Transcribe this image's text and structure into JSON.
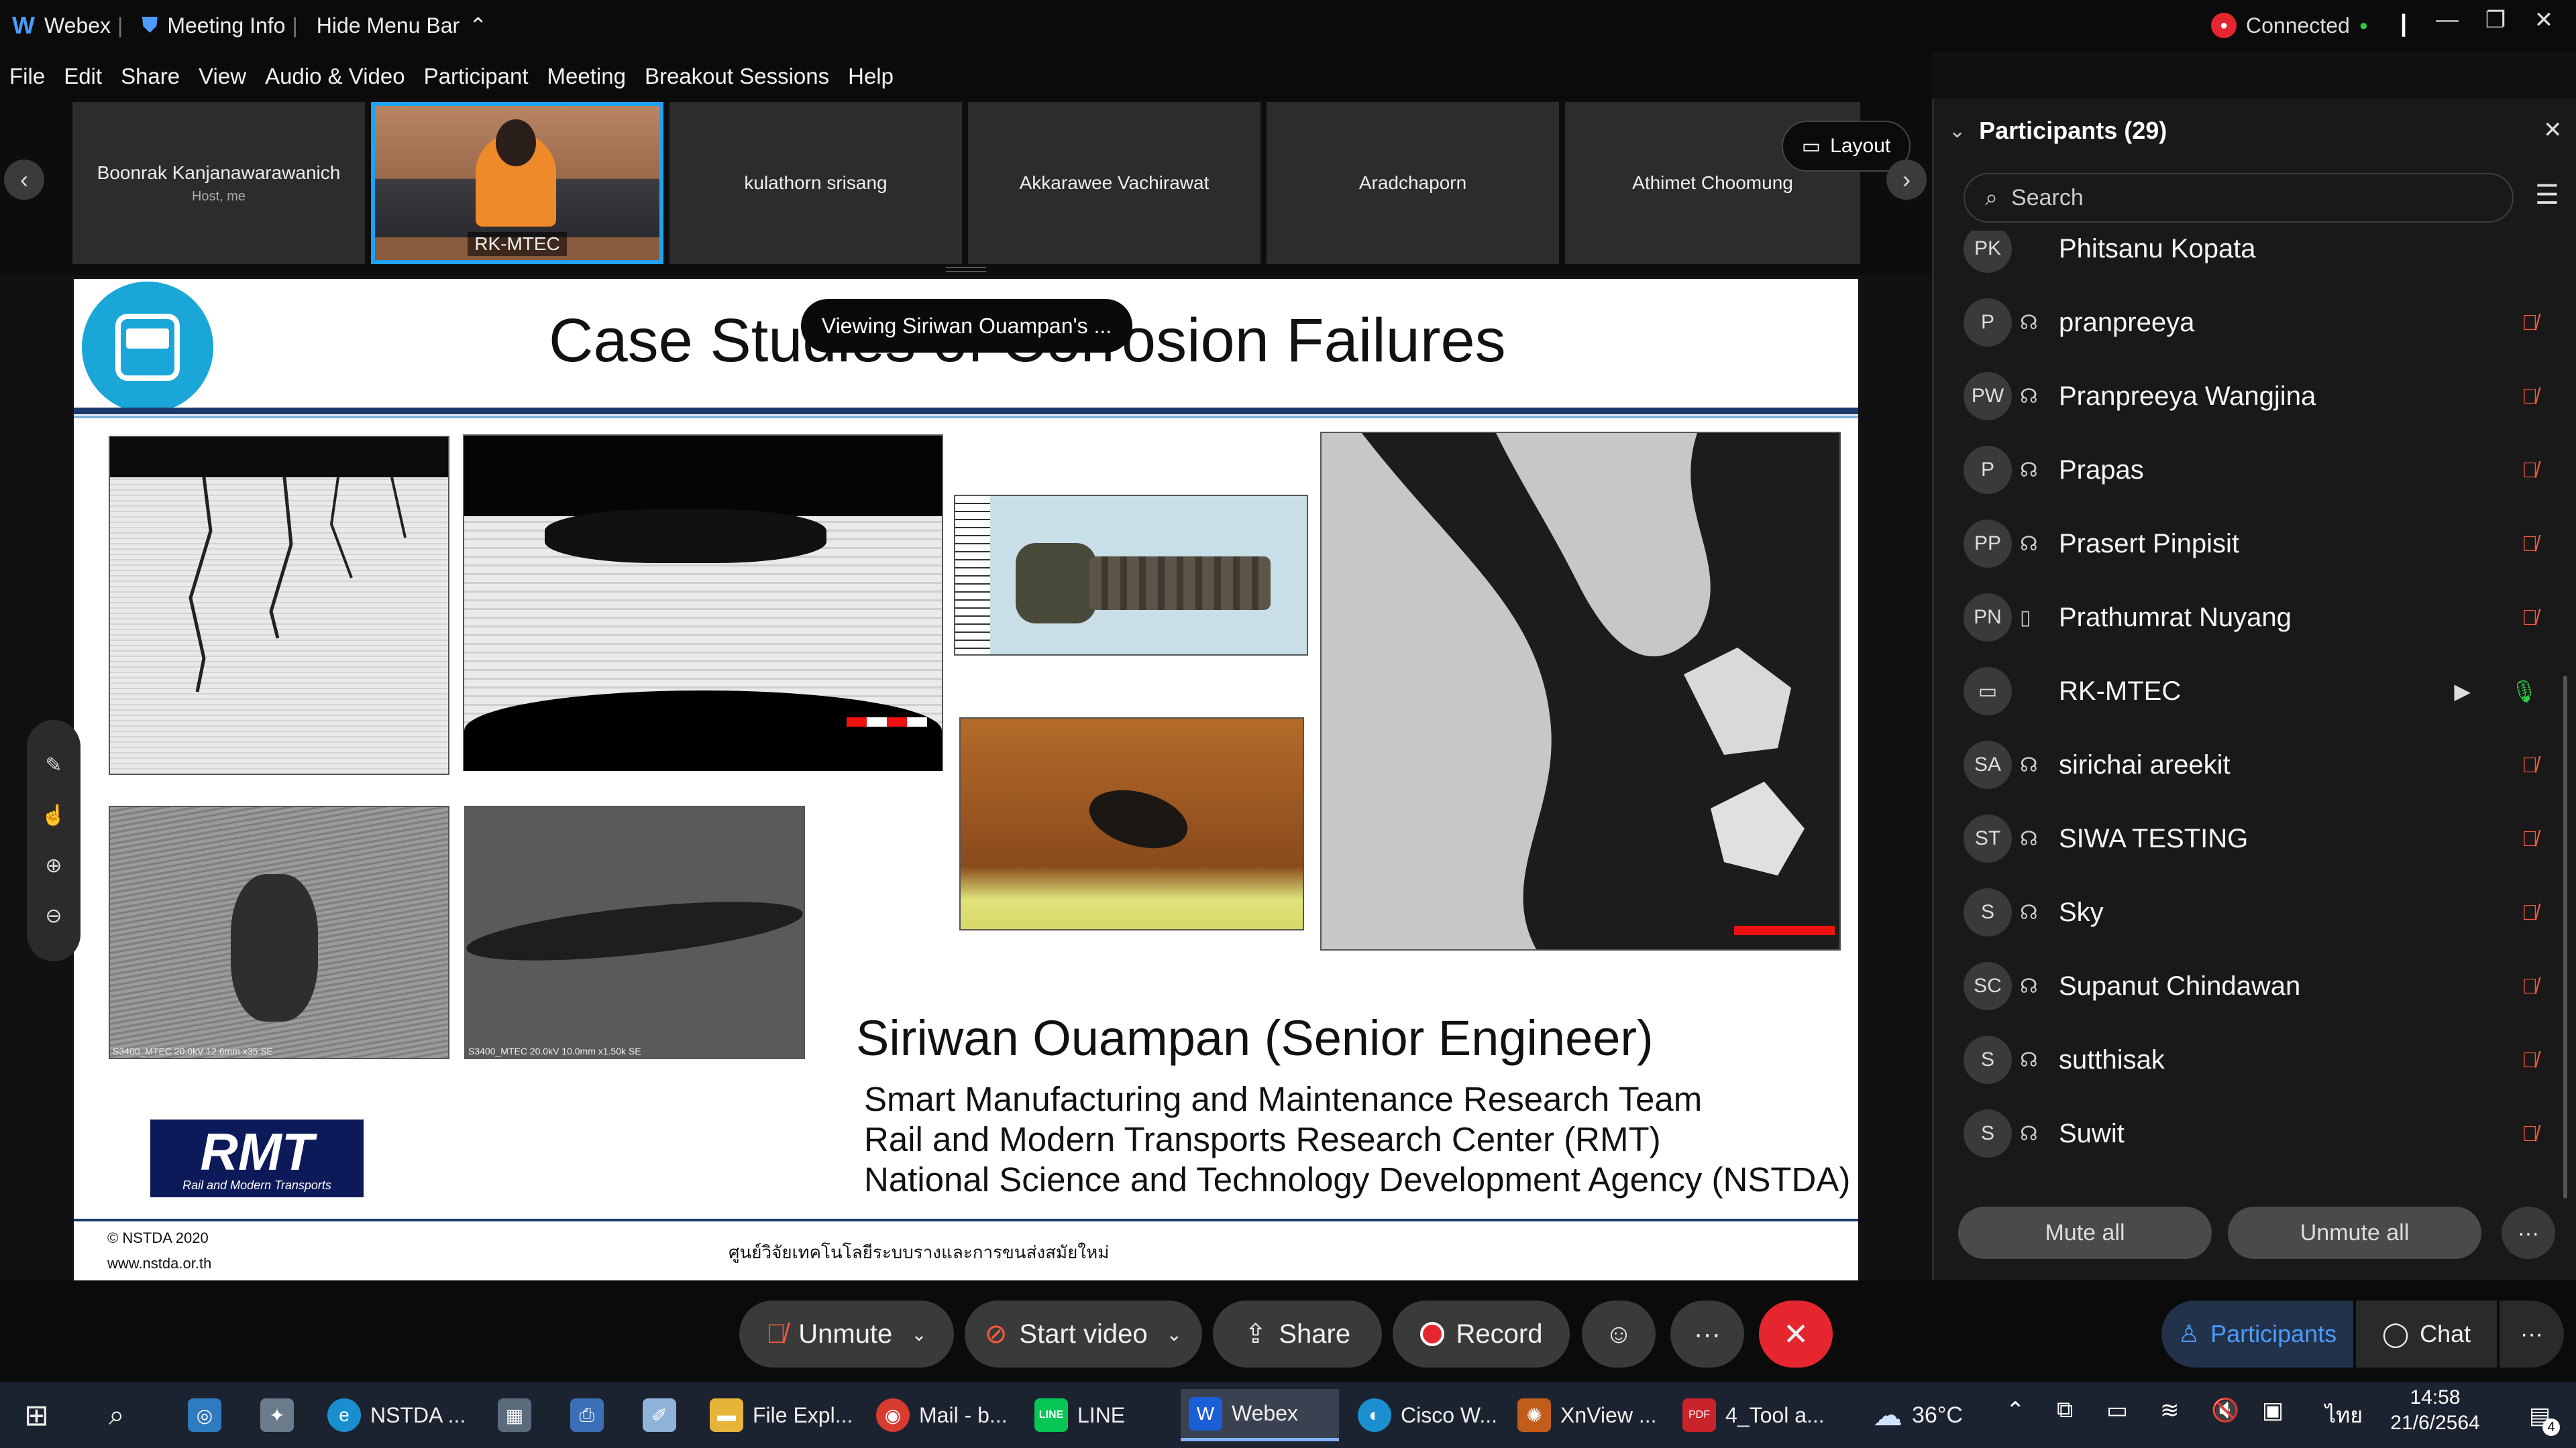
{
  "titlebar": {
    "app_name": "Webex",
    "meeting_info": "Meeting Info",
    "hide_menu": "Hide Menu Bar",
    "status": "Connected"
  },
  "menu": [
    "File",
    "Edit",
    "Share",
    "View",
    "Audio & Video",
    "Participant",
    "Meeting",
    "Breakout Sessions",
    "Help"
  ],
  "filmstrip": {
    "tiles": [
      {
        "name": "Boonrak Kanjanawarawanich",
        "sub": "Host, me"
      },
      {
        "name": "RK-MTEC",
        "sub": ""
      },
      {
        "name": "kulathorn srisang",
        "sub": ""
      },
      {
        "name": "Akkarawee Vachirawat",
        "sub": ""
      },
      {
        "name": "Aradchaporn",
        "sub": ""
      },
      {
        "name": "Athimet Choomung",
        "sub": ""
      }
    ],
    "layout_label": "Layout"
  },
  "share_banner": "Viewing Siriwan Ouampan's ...",
  "slide": {
    "title": "Case Studies of Corrosion Failures",
    "presenter": "Siriwan Ouampan (Senior Engineer)",
    "team_lines": [
      "Smart Manufacturing and Maintenance Research Team",
      "Rail and Modern Transports Research Center (RMT)",
      "National Science and Technology Development Agency (NSTDA)"
    ],
    "logo_text": "RMT",
    "logo_sub": "Rail and Modern Transports",
    "footer_left_1": "© NSTDA 2020",
    "footer_left_2": "www.nstda.or.th",
    "footer_center": "ศูนย์วิจัยเทคโนโลยีระบบรางและการขนส่งสมัยใหม่",
    "sem_label_1": "S3400_MTEC 20.0kV 12.6mm x35 SE",
    "sem_label_2": "S3400_MTEC 20.0kV 10.0mm x1.50k SE"
  },
  "participants": {
    "header": "Participants (29)",
    "search_placeholder": "Search",
    "list": [
      {
        "initials": "PK",
        "name": "Phitsanu Kopata"
      },
      {
        "initials": "P",
        "name": "pranpreeya"
      },
      {
        "initials": "PW",
        "name": "Pranpreeya Wangjina"
      },
      {
        "initials": "P",
        "name": "Prapas"
      },
      {
        "initials": "PP",
        "name": "Prasert Pinpisit"
      },
      {
        "initials": "PN",
        "name": "Prathumrat Nuyang"
      },
      {
        "initials": "",
        "name": "RK-MTEC"
      },
      {
        "initials": "SA",
        "name": "sirichai areekit"
      },
      {
        "initials": "ST",
        "name": "SIWA TESTING"
      },
      {
        "initials": "S",
        "name": "Sky"
      },
      {
        "initials": "SC",
        "name": "Supanut Chindawan"
      },
      {
        "initials": "S",
        "name": "sutthisak"
      },
      {
        "initials": "S",
        "name": "Suwit"
      }
    ],
    "mute_all": "Mute all",
    "unmute_all": "Unmute all"
  },
  "controls": {
    "unmute": "Unmute",
    "start_video": "Start video",
    "share": "Share",
    "record": "Record",
    "participants_tab": "Participants",
    "chat_tab": "Chat"
  },
  "taskbar": {
    "apps": [
      "NSTDA ...",
      "File Expl...",
      "Mail - b...",
      "LINE",
      "Webex",
      "Cisco W...",
      "XnView ...",
      "4_Tool a..."
    ],
    "weather": "36°C",
    "lang": "ไทย",
    "time": "14:58",
    "date": "21/6/2564",
    "notifications": "4"
  },
  "colors": {
    "accent_blue": "#4c9bff",
    "record_red": "#e5262f",
    "mic_muted": "#ff5a3c",
    "status_green": "#2ecc40"
  }
}
